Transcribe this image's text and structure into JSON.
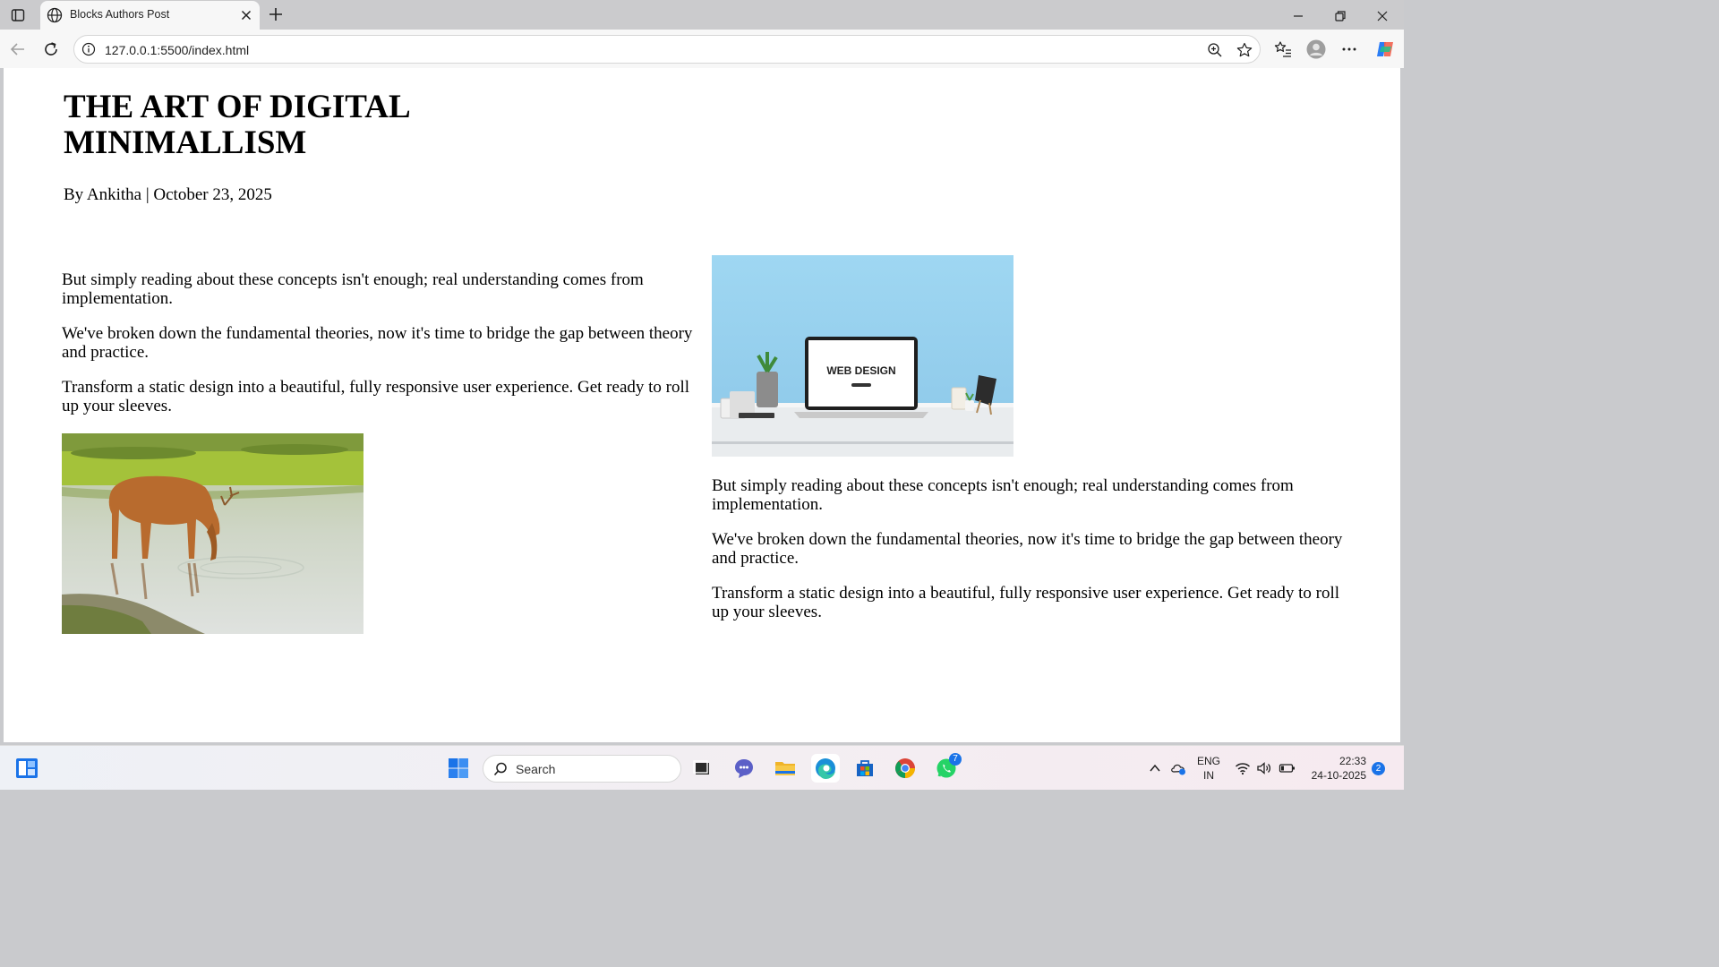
{
  "browser": {
    "tab_title": "Blocks Authors Post",
    "url": "127.0.0.1:5500/index.html"
  },
  "article": {
    "title": "THE ART OF DIGITAL MINIMALLISM",
    "byline": "By Ankitha | October 23, 2025",
    "left_paragraphs": [
      "But simply reading about these concepts isn't enough; real understanding comes from implementation.",
      "We've broken down the fundamental theories, now it's time to bridge the gap between theory and practice.",
      "Transform a static design into a beautiful, fully responsive user experience. Get ready to roll up your sleeves."
    ],
    "right_paragraphs": [
      "But simply reading about these concepts isn't enough; real understanding comes from implementation.",
      "We've broken down the fundamental theories, now it's time to bridge the gap between theory and practice.",
      "Transform a static design into a beautiful, fully responsive user experience. Get ready to roll up your sleeves."
    ],
    "laptop_screen_text": "WEB DESIGN"
  },
  "taskbar": {
    "search_placeholder": "Search",
    "whatsapp_badge": "7",
    "language_line1": "ENG",
    "language_line2": "IN",
    "time": "22:33",
    "date": "24-10-2025",
    "notification_count": "2"
  },
  "colors": {
    "accent": "#1a73e8",
    "tabstrip": "#cbcbcd",
    "toolbar": "#f7f7f7"
  }
}
